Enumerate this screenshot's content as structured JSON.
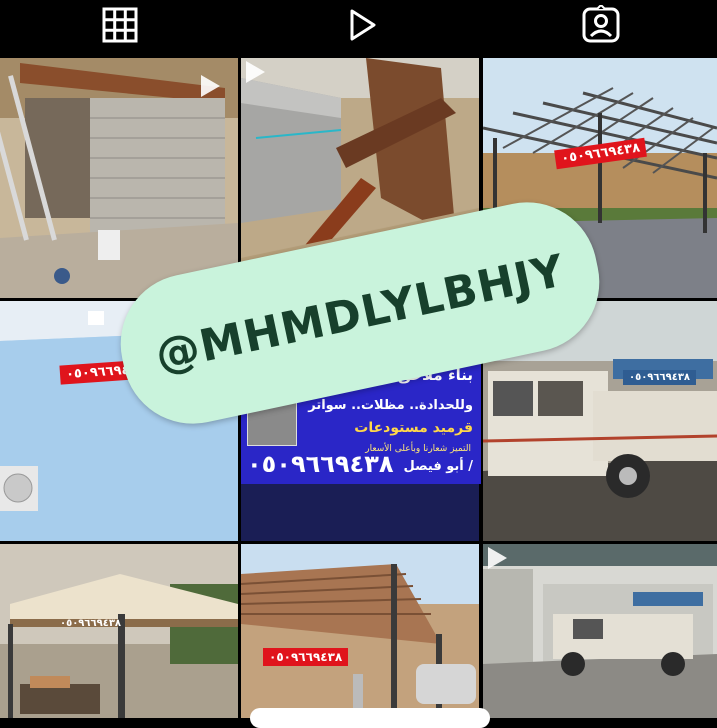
{
  "tabs": [
    {
      "name": "posts-grid-tab",
      "icon": "grid-icon",
      "active": true
    },
    {
      "name": "reels-tab",
      "icon": "play-icon",
      "active": false
    },
    {
      "name": "tagged-tab",
      "icon": "tagged-person-icon",
      "active": false
    }
  ],
  "watermark": {
    "text": "@MHMDLYLBHJY"
  },
  "phone_tags": {
    "t1": "٠٥٠٩٦٦٩٤٣٨",
    "t2": "٠٥٠٩٦٦٩٤",
    "t3": "٠٥٠٩٦٦٩٤٣٨",
    "t4": "٠٥٠٩٦٦٩٤٣٨",
    "t5": "٠٥٠٩٦٦٩٤٣٨"
  },
  "ad": {
    "line1": "بناء ملاحق وترميم",
    "line2": "وللحدادة.. مظلات.. سواتر",
    "line3": "قرميد مستودعات",
    "line4": "التميز شعارنا وبأعلى الأسعار",
    "phone": "٠٥٠٩٦٦٩٤٣٨",
    "name": "أبو فيصل /"
  },
  "colors": {
    "background": "#000000",
    "watermark": "#c9f3dc",
    "ad_blue": "#2a26c7",
    "tag_red": "#e0141c"
  }
}
